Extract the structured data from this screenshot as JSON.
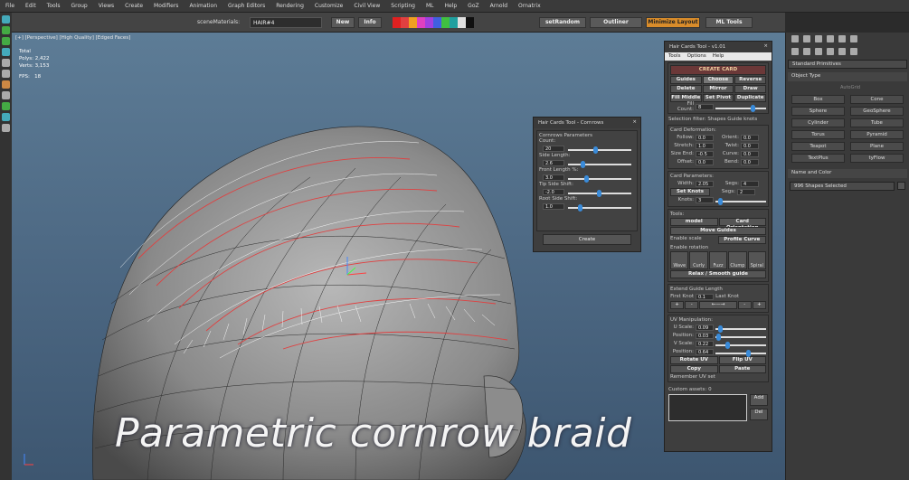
{
  "menu": [
    "File",
    "Edit",
    "Tools",
    "Group",
    "Views",
    "Create",
    "Modifiers",
    "Animation",
    "Graph Editors",
    "Rendering",
    "Customize",
    "Civil View",
    "Scripting",
    "ML",
    "Help",
    "GoZ",
    "Arnold",
    "Ornatrix"
  ],
  "toolbar": {
    "scene_label": "sceneMaterials:",
    "scene_value": "HAIR#4",
    "new_btn": "New",
    "info_btn": "Info",
    "setrandom_btn": "setRandom",
    "outliner_btn": "Outliner",
    "minimize_btn": "Minimize Layout",
    "mltools_btn": "ML Tools",
    "swatches": [
      "#e02020",
      "#e04040",
      "#f0a020",
      "#e040c0",
      "#a040e0",
      "#4060e0",
      "#40c040",
      "#20a0a0",
      "#e0e0e0",
      "#101010"
    ]
  },
  "viewport": {
    "label": "[+] [Perspective] [High Quality] [Edged Faces]",
    "stats_total": "Total",
    "polys": "Polys: 2,422",
    "verts": "Verts: 3,153",
    "fps_label": "FPS:",
    "fps": "18",
    "caption": "Parametric cornrow braid"
  },
  "right_panel": {
    "dropdown": "Standard Primitives",
    "object_type": "Object Type",
    "autogrid": "AutoGrid",
    "objects": [
      "Box",
      "Cone",
      "Sphere",
      "GeoSphere",
      "Cylinder",
      "Tube",
      "Torus",
      "Pyramid",
      "Teapot",
      "Plane",
      "TextPlus",
      "tyFlow"
    ],
    "name_color": "Name and Color",
    "selected": "996 Shapes Selected"
  },
  "cornrows": {
    "title": "Hair Cards Tool - Cornrows",
    "params": "Cornrows Parameters",
    "count_label": "Count:",
    "count": "20",
    "side_len_label": "Side Length:",
    "side_len": "2.6",
    "front_len_label": "Front Length %:",
    "front_len": "3.0",
    "tip_shift_label": "Tip Side Shift:",
    "tip_shift": "-2.0",
    "root_shift_label": "Root Side Shift:",
    "root_shift": "1.0",
    "create": "Create"
  },
  "hct": {
    "title": "Hair Cards Tool - v1.01",
    "menu": [
      "Tools",
      "Options",
      "Help"
    ],
    "create_card": "CREATE CARD",
    "row1": [
      "Guides",
      "Choose",
      "Reverse"
    ],
    "row2": [
      "Delete",
      "Mirror",
      "Draw"
    ],
    "row3": [
      "Fill Middle",
      "Set Pivot",
      "Duplicate"
    ],
    "fill_count_label": "Fill Count:",
    "fill_count": "8",
    "sel_filter": "Selection filter:  Shapes     Guide knots",
    "card_def": "Card Deformation:",
    "follow_label": "Follow:",
    "follow": "0.0",
    "orient_label": "Orient:",
    "orient": "0.0",
    "stretch_label": "Stretch:",
    "stretch": "1.0",
    "twist_label": "Twist:",
    "twist": "0.0",
    "size_end_label": "Size End:",
    "size_end": "-0.5",
    "curve_label": "Curve:",
    "curve": "0.0",
    "offset_label": "Offset:",
    "offset": "0.0",
    "bend_label": "Bend:",
    "bend": "0.0",
    "card_params": "Card Parameters:",
    "width_label": "Width:",
    "width": "2.05",
    "segs_label": "Segs:",
    "segs": "4",
    "set_knots": "Set Knots",
    "segs2": "2",
    "knots_label": "Knots:",
    "knots": "3",
    "tools": "Tools:",
    "model": "model",
    "card_orientation": "Card Orientation",
    "move_guides": "Move Guides",
    "enable_scale": "Enable scale",
    "profile_curve": "Profile Curve",
    "enable_rotation": "Enable rotation",
    "wave_icons": [
      "Wave",
      "Curly",
      "Fuzz",
      "Clump",
      "Spiral"
    ],
    "relax": "Relax / Smooth guide",
    "extend": "Extend Guide Length",
    "first_knot": "First Knot",
    "value": "0.1",
    "last_knot": "Last Knot",
    "uv_manip": "UV Manipulation:",
    "u_scale_label": "U Scale:",
    "u_scale": "0.09",
    "position_label": "Position:",
    "pos1": "0.03",
    "v_scale_label": "V Scale:",
    "v_scale": "0.22",
    "pos2": "0.64",
    "rotate_uv": "Rotate UV",
    "flip_uv": "Flip UV",
    "copy": "Copy",
    "paste": "Paste",
    "remember": "Remember UV set",
    "custom_assets": "Custom assets:",
    "custom_count": "0",
    "add": "Add",
    "del": "Del"
  }
}
